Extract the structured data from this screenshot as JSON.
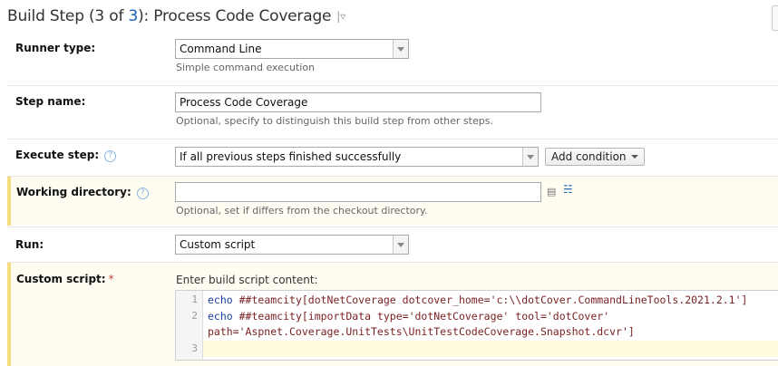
{
  "header": {
    "prefix": "Build Step (3 of ",
    "total_link": "3",
    "suffix": "): Process Code Coverage",
    "menu_glyph": "|▿"
  },
  "runner_type": {
    "label": "Runner type:",
    "value": "Command Line",
    "note": "Simple command execution"
  },
  "step_name": {
    "label": "Step name:",
    "value": "Process Code Coverage",
    "note": "Optional, specify to distinguish this build step from other steps."
  },
  "execute_step": {
    "label": "Execute step:",
    "help": "?",
    "value": "If all previous steps finished successfully",
    "add_condition": "Add condition"
  },
  "working_directory": {
    "label": "Working directory:",
    "help": "?",
    "value": "",
    "note": "Optional, set if differs from the checkout directory.",
    "icons": [
      "list-icon",
      "tree-icon"
    ]
  },
  "run": {
    "label": "Run:",
    "value": "Custom script"
  },
  "custom_script": {
    "label": "Custom script:",
    "required": "*",
    "caption": "Enter build script content:",
    "line_numbers": [
      "1",
      "2",
      "3"
    ],
    "lines": [
      {
        "cmd": "echo",
        "rest": " ##teamcity[dotNetCoverage dotcover_home='c:\\\\dotCover.CommandLineTools.2021.2.1']"
      },
      {
        "cmd": "echo",
        "rest": " ##teamcity[importData type='dotNetCoverage' tool='dotCover'"
      },
      {
        "cmd": "",
        "rest": "path='Aspnet.Coverage.UnitTests\\UnitTestCodeCoverage.Snapshot.dcvr']"
      }
    ]
  }
}
